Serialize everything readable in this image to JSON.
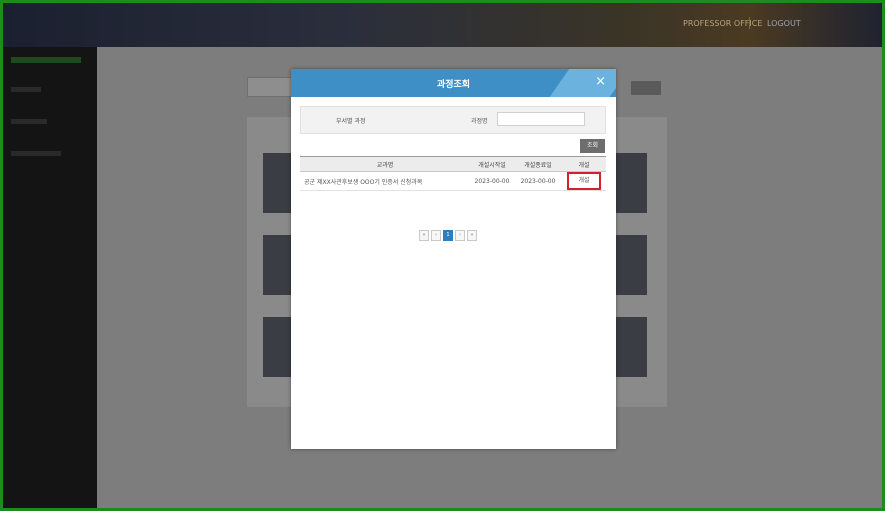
{
  "header": {
    "user_text": "PROFESSOR OFFICE",
    "logout_label": "LOGOUT"
  },
  "modal": {
    "title": "과정조회",
    "close_glyph": "×",
    "filter_label": "부서별 과정",
    "course_label": "과정명",
    "course_input_value": "",
    "search_button": "조회",
    "table": {
      "headers": [
        "교과명",
        "개설시작일",
        "개설종료일",
        "개설"
      ],
      "rows": [
        {
          "name": "공군 제XX사관후보생 OOO기 인증서 신청과목",
          "start": "2023-00-00",
          "end": "2023-00-00",
          "action": "개설"
        }
      ]
    },
    "pagination": [
      "«",
      "‹",
      "1",
      "›",
      "»"
    ],
    "current_page": "1"
  },
  "colors": {
    "modal_header": "#3d8fc6",
    "highlight_border": "#d32030",
    "screenshot_border": "#1f8a1f"
  }
}
